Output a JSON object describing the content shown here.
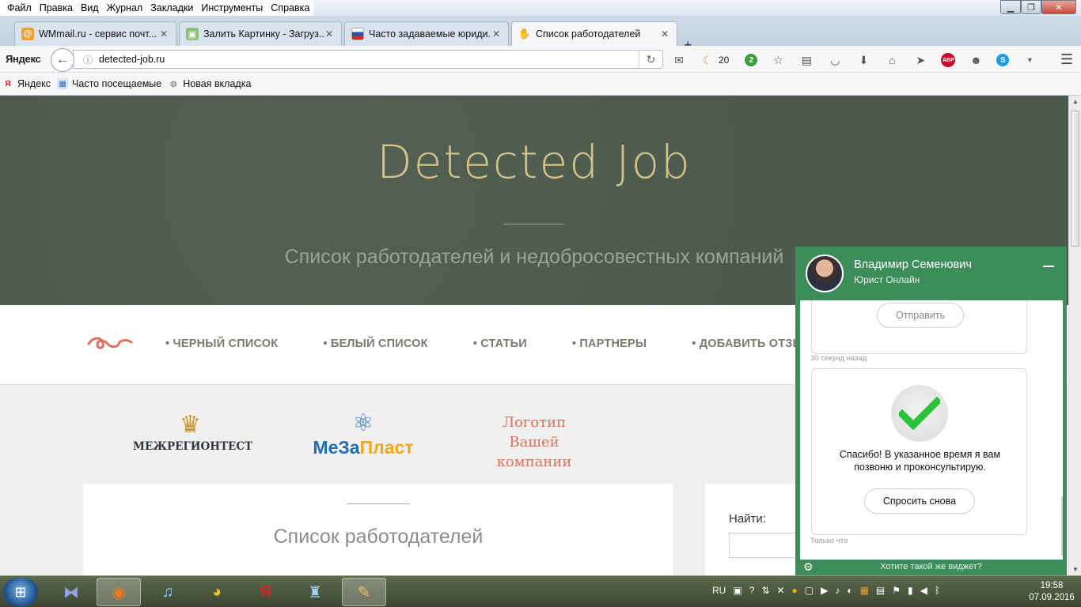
{
  "menubar": {
    "items": [
      "Файл",
      "Правка",
      "Вид",
      "Журнал",
      "Закладки",
      "Инструменты",
      "Справка"
    ]
  },
  "tabs": [
    {
      "title": "WMmail.ru - сервис почт...",
      "icon": "wmmail-icon"
    },
    {
      "title": "Залить Картинку - Загруз...",
      "icon": "image-upload-icon"
    },
    {
      "title": "Часто задаваемые юриди...",
      "icon": "russia-flag-icon"
    },
    {
      "title": "Список работодателей",
      "icon": "hand-icon",
      "active": true
    }
  ],
  "navbar": {
    "yandex_logo": "Яндекс",
    "url": "detected-job.ru",
    "weather_temp": "20",
    "badge_count": "2",
    "abp_label": "ABP"
  },
  "bookmarks": [
    "Яндекс",
    "Часто посещаемые",
    "Новая вкладка"
  ],
  "site": {
    "title": "Detected Job",
    "subtitle": "Список работодателей и недобросовестных компаний",
    "nav": [
      "• ЧЕРНЫЙ СПИСОК",
      "• БЕЛЫЙ СПИСОК",
      "• СТАТЬИ",
      "• ПАРТНЕРЫ",
      "• ДОБАВИТЬ ОТЗЫВ"
    ],
    "partners": {
      "logo1": "МЕЖРЕГИОНТЕСТ",
      "logo2_a": "МеЗа",
      "logo2_b": "Пласт",
      "logo3_line1": "Логотип",
      "logo3_line2": "Вашей",
      "logo3_line3": "компании"
    },
    "main_title": "Список работодателей",
    "search_label": "Найти:"
  },
  "chat": {
    "agent_name": "Владимир Семенович",
    "agent_role": "Юрист Онлайн",
    "send_button": "Отправить",
    "timestamp1": "30 секунд назад",
    "thanks_text": "Спасибо! В указанное время я вам позвоню и проконсультирую.",
    "ask_again_button": "Спросить снова",
    "timestamp2": "Только что",
    "footer_link": "Хотите такой же виджет?"
  },
  "taskbar": {
    "lang": "RU",
    "time": "19:58",
    "date": "07.09.2016"
  },
  "colors": {
    "hero_bg": "#4c5a4c",
    "hero_title": "#d4c38a",
    "chat_green": "#3d8d5b",
    "accent_orange": "#e0705a"
  }
}
